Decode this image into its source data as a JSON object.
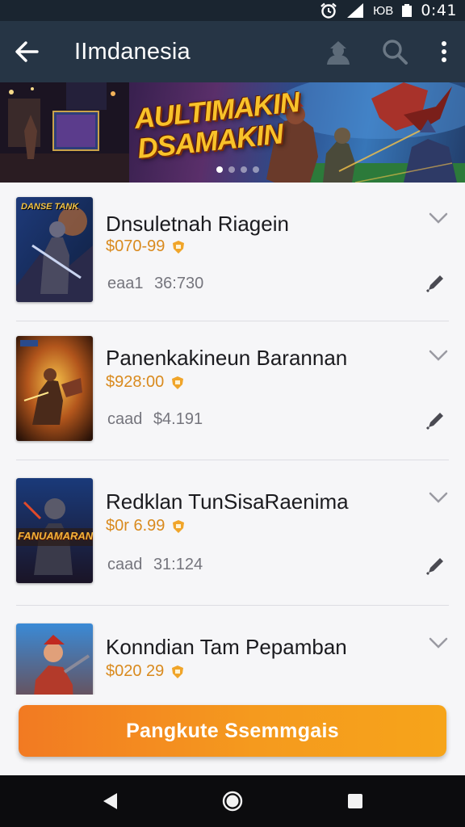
{
  "status_bar": {
    "code": "ЮB",
    "time": "0:41"
  },
  "app_bar": {
    "title": "IImdanesia",
    "icons": [
      "back-arrow-icon",
      "profile-icon",
      "search-icon",
      "more-vert-icon"
    ]
  },
  "banner": {
    "text_line1": "AULTIMAKIN",
    "text_line2": "DSAMAKIN",
    "dots": 4,
    "active_dot": 0
  },
  "thumbnails": {
    "item1_caption": "DANSE TANK",
    "item3_caption": "FANUAMARAN"
  },
  "items": [
    {
      "title": "Dnsuletnah Riagein",
      "price": "$070-99",
      "meta_label": "eaa1",
      "meta_value": "36:730"
    },
    {
      "title": "Panenkakineun Barannan",
      "price": "$928:00",
      "meta_label": "caad",
      "meta_value": "$4.191"
    },
    {
      "title": "Redklan TunSisaRaenima",
      "price": "$0r 6.99",
      "meta_label": "caad",
      "meta_value": "31:124"
    },
    {
      "title": "Konndian Tam Pepamban",
      "price": "$020 29",
      "meta_label": "",
      "meta_value": ""
    }
  ],
  "cta": {
    "label": "Pangkute Ssemmgais"
  },
  "colors": {
    "app_bar": "#263545",
    "status_bar": "#1a2530",
    "price": "#d98a1e",
    "cta_start": "#f27a22",
    "cta_end": "#f6a41a",
    "nav_bar": "#0c0c0e"
  }
}
